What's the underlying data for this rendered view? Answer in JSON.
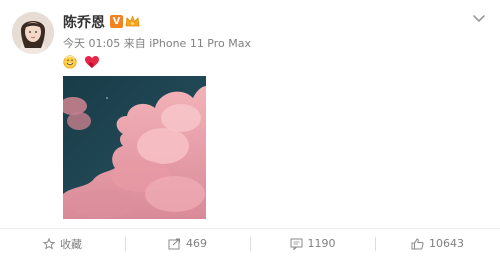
{
  "post": {
    "username": "陈乔恩",
    "verified_badge": "V",
    "meta": "今天 01:05 来自 iPhone 11 Pro Max",
    "content_icons": [
      "smiling-face-icon",
      "heart-icon"
    ],
    "image_alt": "pink-clouds-photo"
  },
  "actions": {
    "favorite_label": "收藏",
    "repost_count": "469",
    "comment_count": "1190",
    "like_count": "10643"
  },
  "colors": {
    "verified": "#f58220",
    "meta_text": "#808080",
    "photo_sky": "#1f4654",
    "photo_cloud": "#e8a0a8"
  }
}
